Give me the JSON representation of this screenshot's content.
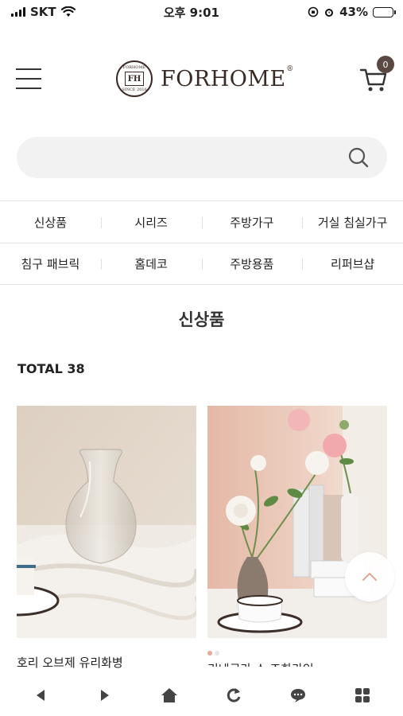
{
  "status_bar": {
    "carrier": "SKT",
    "time": "오후 9:01",
    "battery": "43%",
    "battery_level": 0.43
  },
  "header": {
    "logo_text": "FORHOME",
    "logo_mark": "®",
    "seal_initials": "FH",
    "seal_top": "FORHOME",
    "seal_bottom": "SINCE 2016",
    "cart_count": "0"
  },
  "search": {
    "placeholder": ""
  },
  "categories": {
    "row1": [
      "신상품",
      "시리즈",
      "주방가구",
      "거실 침실가구"
    ],
    "row2": [
      "침구 패브릭",
      "홈데코",
      "주방용품",
      "리퍼브샵"
    ]
  },
  "page_title": "신상품",
  "total_label": "TOTAL 38",
  "products": [
    {
      "name": "호리 오브제 유리화병"
    },
    {
      "name": "리네르라 스 조화라인"
    }
  ],
  "colors": {
    "brand": "#3a2a25",
    "badge": "#5a4942",
    "accent_dot": "#e8a89a"
  }
}
